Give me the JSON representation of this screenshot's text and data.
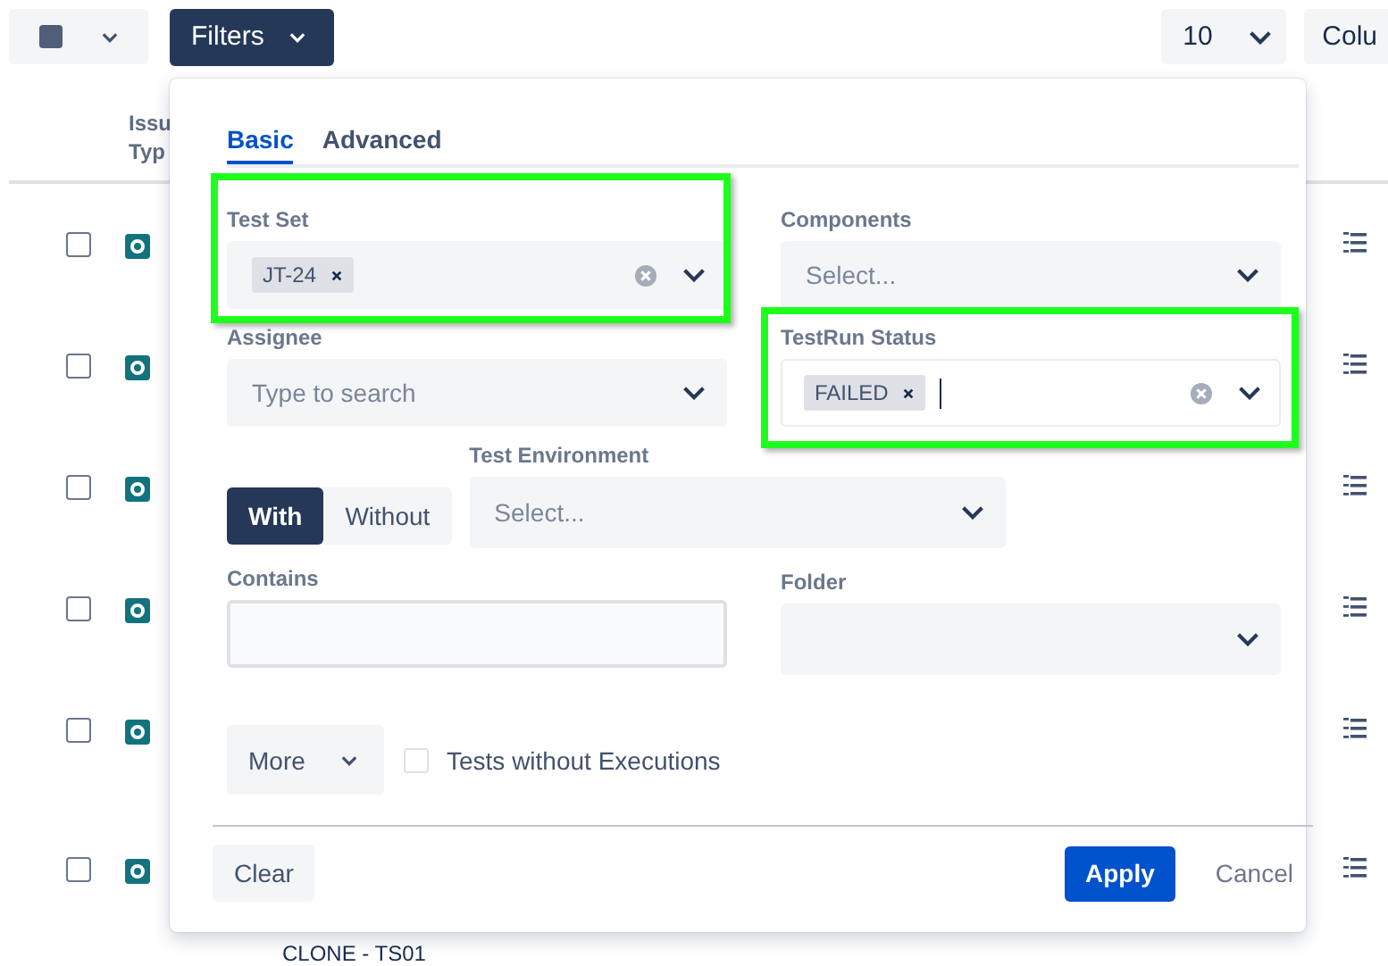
{
  "toolbar": {
    "select_all": {
      "checked": false
    },
    "filters_button": "Filters",
    "page_size": "10",
    "columns_button": "Colu"
  },
  "table": {
    "header": [
      "Issu",
      "Typ"
    ],
    "rows": [
      {
        "checked": false
      },
      {
        "checked": false
      },
      {
        "checked": false
      },
      {
        "checked": false
      },
      {
        "checked": false
      },
      {
        "checked": false
      }
    ],
    "footer_text": "CLONE - TS01"
  },
  "filter_panel": {
    "tabs": [
      {
        "label": "Basic",
        "selected": true
      },
      {
        "label": "Advanced",
        "selected": false
      }
    ],
    "test_set": {
      "label": "Test Set",
      "tags": [
        "JT-24"
      ],
      "highlighted": true,
      "focused": false
    },
    "components": {
      "label": "Components",
      "placeholder": "Select..."
    },
    "assignee": {
      "label": "Assignee",
      "placeholder": "Type to search"
    },
    "testrun_status": {
      "label": "TestRun Status",
      "tags": [
        "FAILED"
      ],
      "highlighted": true,
      "focused": true
    },
    "toggle": [
      {
        "label": "With",
        "selected": true
      },
      {
        "label": "Without",
        "selected": false
      }
    ],
    "test_environment": {
      "label": "Test Environment",
      "placeholder": "Select..."
    },
    "contains": {
      "label": "Contains"
    },
    "folder": {
      "label": "Folder"
    },
    "more_button": "More",
    "tests_without_executions": {
      "label": "Tests without Executions",
      "checked": false
    },
    "buttons": {
      "clear": "Clear",
      "apply": "Apply",
      "cancel": "Cancel"
    }
  }
}
